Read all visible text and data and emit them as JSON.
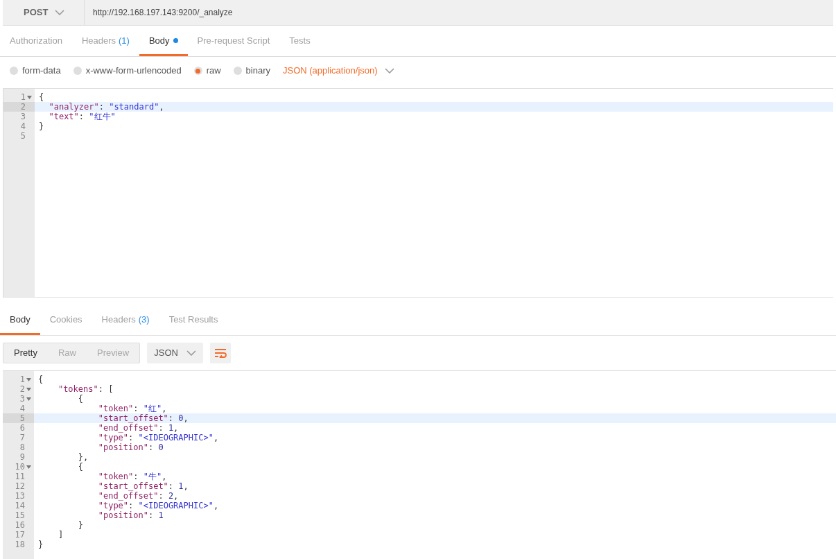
{
  "request": {
    "method": "POST",
    "url": "http://192.168.197.143:9200/_analyze"
  },
  "request_tabs": [
    {
      "label": "Authorization",
      "selected": false
    },
    {
      "label": "Headers",
      "count": "(1)",
      "selected": false
    },
    {
      "label": "Body",
      "dot": true,
      "selected": true
    },
    {
      "label": "Pre-request Script",
      "selected": false
    },
    {
      "label": "Tests",
      "selected": false
    }
  ],
  "body_types": [
    {
      "label": "form-data",
      "selected": false
    },
    {
      "label": "x-www-form-urlencoded",
      "selected": false
    },
    {
      "label": "raw",
      "selected": true
    },
    {
      "label": "binary",
      "selected": false
    }
  ],
  "content_type": "JSON (application/json)",
  "request_editor": [
    {
      "number": "1",
      "text": "{",
      "foldable": true,
      "active": false
    },
    {
      "number": "2",
      "text": "  \"analyzer\": \"standard\",",
      "foldable": false,
      "active": true
    },
    {
      "number": "3",
      "text": "  \"text\": \"红牛\"",
      "foldable": false,
      "active": false
    },
    {
      "number": "4",
      "text": "}",
      "foldable": false,
      "active": false
    },
    {
      "number": "5",
      "foldable": false,
      "active": false
    }
  ],
  "response_tabs": [
    {
      "label": "Body",
      "selected": true
    },
    {
      "label": "Cookies",
      "selected": false
    },
    {
      "label": "Headers",
      "count": "(3)",
      "selected": false
    },
    {
      "label": "Test Results",
      "selected": false
    }
  ],
  "view_modes": [
    {
      "label": "Pretty",
      "selected": true
    },
    {
      "label": "Raw",
      "selected": false
    },
    {
      "label": "Preview",
      "selected": false
    }
  ],
  "format": "JSON",
  "response_editor": [
    {
      "number": "1",
      "text": "{",
      "foldable": true,
      "active": false
    },
    {
      "number": "2",
      "text": "    \"tokens\": [",
      "foldable": true,
      "active": false
    },
    {
      "number": "3",
      "text": "        {",
      "foldable": true,
      "active": false
    },
    {
      "number": "4",
      "text": "            \"token\": \"红\",",
      "foldable": false,
      "active": false
    },
    {
      "number": "5",
      "text": "            \"start_offset\": 0,",
      "foldable": false,
      "active": true
    },
    {
      "number": "6",
      "text": "            \"end_offset\": 1,",
      "foldable": false,
      "active": false
    },
    {
      "number": "7",
      "text": "            \"type\": \"<IDEOGRAPHIC>\",",
      "foldable": false,
      "active": false
    },
    {
      "number": "8",
      "text": "            \"position\": 0",
      "foldable": false,
      "active": false
    },
    {
      "number": "9",
      "text": "        },",
      "foldable": false,
      "active": false
    },
    {
      "number": "10",
      "text": "        {",
      "foldable": true,
      "active": false
    },
    {
      "number": "11",
      "text": "            \"token\": \"牛\",",
      "foldable": false,
      "active": false
    },
    {
      "number": "12",
      "text": "            \"start_offset\": 1,",
      "foldable": false,
      "active": false
    },
    {
      "number": "13",
      "text": "            \"end_offset\": 2,",
      "foldable": false,
      "active": false
    },
    {
      "number": "14",
      "text": "            \"type\": \"<IDEOGRAPHIC>\",",
      "foldable": false,
      "active": false
    },
    {
      "number": "15",
      "text": "            \"position\": 1",
      "foldable": false,
      "active": false
    },
    {
      "number": "16",
      "text": "        }",
      "foldable": false,
      "active": false
    },
    {
      "number": "17",
      "text": "    ]",
      "foldable": false,
      "active": false
    },
    {
      "number": "18",
      "text": "}",
      "foldable": false,
      "active": false
    }
  ]
}
